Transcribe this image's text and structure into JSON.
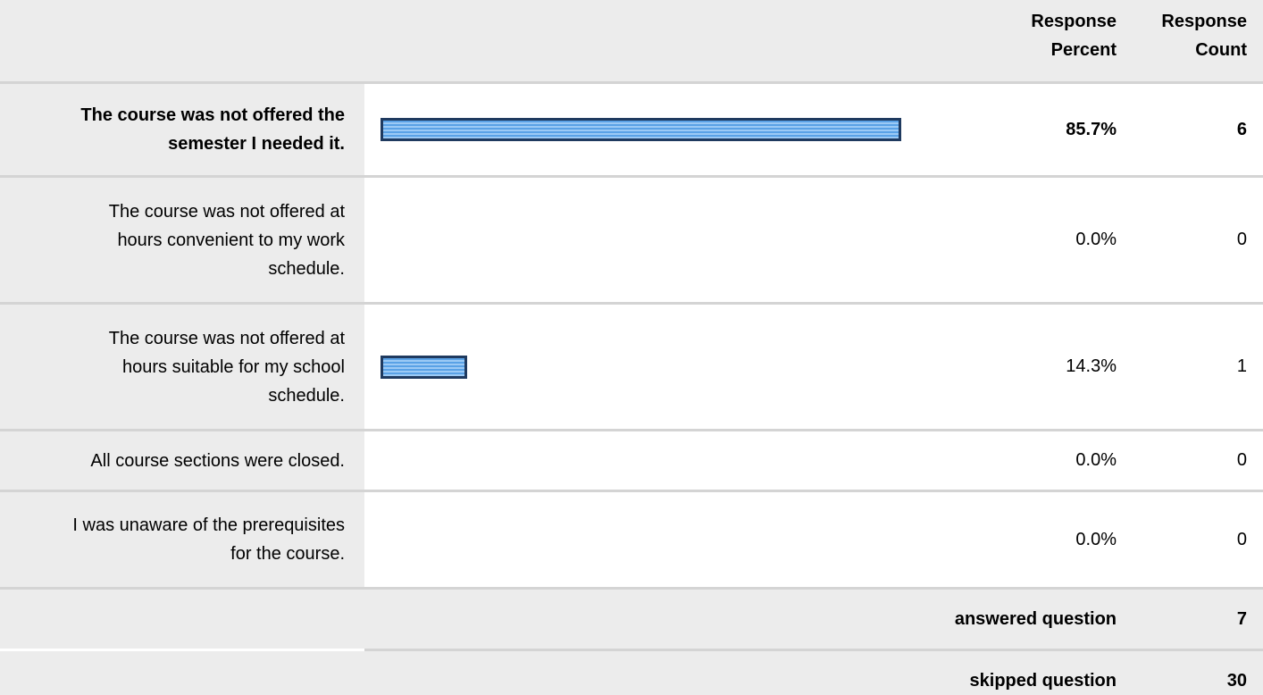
{
  "header": {
    "percent_line1": "Response",
    "percent_line2": "Percent",
    "count_line1": "Response",
    "count_line2": "Count"
  },
  "rows": [
    {
      "label_lines": [
        "The course was not offered the",
        "semester I needed it."
      ],
      "percent": "85.7%",
      "count": "6",
      "bold": true
    },
    {
      "label_lines": [
        "The course was not offered at",
        "hours convenient to my work",
        "schedule."
      ],
      "percent": "0.0%",
      "count": "0",
      "bold": false
    },
    {
      "label_lines": [
        "The course was not offered at",
        "hours suitable for my school",
        "schedule."
      ],
      "percent": "14.3%",
      "count": "1",
      "bold": false
    },
    {
      "label_lines": [
        "All course sections were closed."
      ],
      "percent": "0.0%",
      "count": "0",
      "bold": false
    },
    {
      "label_lines": [
        "I was unaware of the prerequisites",
        "for the course."
      ],
      "percent": "0.0%",
      "count": "0",
      "bold": false
    }
  ],
  "footer": {
    "answered_label": "answered question",
    "answered_count": "7",
    "skipped_label": "skipped question",
    "skipped_count": "30"
  },
  "colors": {
    "bar_fill": "#5aa2e6",
    "bar_highlight": "#9ccaf5",
    "bar_border": "#1f3a5f",
    "label_background": "#ececec"
  },
  "chart_data": {
    "type": "bar",
    "orientation": "horizontal",
    "categories": [
      "The course was not offered the semester I needed it.",
      "The course was not offered at hours convenient to my work schedule.",
      "The course was not offered at hours suitable for my school schedule.",
      "All course sections were closed.",
      "I was unaware of the prerequisites for the course."
    ],
    "series": [
      {
        "values": [
          85.7,
          0.0,
          14.3,
          0.0,
          0.0
        ]
      }
    ],
    "counts": [
      6,
      0,
      1,
      0,
      0
    ],
    "xlim": [
      0,
      100
    ],
    "grid": false
  }
}
